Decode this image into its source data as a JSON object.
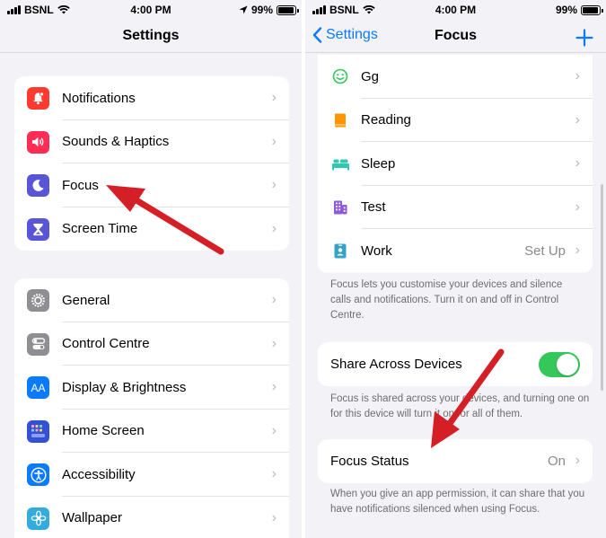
{
  "left": {
    "status": {
      "carrier": "BSNL",
      "time": "4:00 PM",
      "battery": "99%"
    },
    "nav": {
      "title": "Settings"
    },
    "group1": [
      {
        "label": "Notifications",
        "icon": "bell-icon",
        "color": "#ff3b30"
      },
      {
        "label": "Sounds & Haptics",
        "icon": "speaker-icon",
        "color": "#ff2d55"
      },
      {
        "label": "Focus",
        "icon": "moon-icon",
        "color": "#5856d6"
      },
      {
        "label": "Screen Time",
        "icon": "hourglass-icon",
        "color": "#5856d6"
      }
    ],
    "group2": [
      {
        "label": "General",
        "icon": "gear-icon",
        "color": "#8e8e93"
      },
      {
        "label": "Control Centre",
        "icon": "switches-icon",
        "color": "#8e8e93"
      },
      {
        "label": "Display & Brightness",
        "icon": "text-size-icon",
        "color": "#0a7aff"
      },
      {
        "label": "Home Screen",
        "icon": "app-grid-icon",
        "color": "#3450d6"
      },
      {
        "label": "Accessibility",
        "icon": "accessibility-icon",
        "color": "#0a7aff"
      },
      {
        "label": "Wallpaper",
        "icon": "flower-icon",
        "color": "#35aadc"
      }
    ]
  },
  "right": {
    "status": {
      "carrier": "BSNL",
      "time": "4:00 PM",
      "battery": "99%"
    },
    "nav": {
      "back_label": "Settings",
      "title": "Focus"
    },
    "focus_modes": [
      {
        "label": "Gg",
        "icon": "smiley-icon",
        "color": "#34c759"
      },
      {
        "label": "Reading",
        "icon": "book-icon",
        "color": "#ff9500"
      },
      {
        "label": "Sleep",
        "icon": "bed-icon",
        "color": "#30c9b0"
      },
      {
        "label": "Test",
        "icon": "building-icon",
        "color": "#8e5ad7"
      },
      {
        "label": "Work",
        "icon": "badge-icon",
        "color": "#35a2c9",
        "value": "Set Up"
      }
    ],
    "focus_note": "Focus lets you customise your devices and silence calls and notifications. Turn it on and off in Control Centre.",
    "share": {
      "label": "Share Across Devices",
      "enabled": true
    },
    "share_note": "Focus is shared across your devices, and turning one on for this device will turn it on for all of them.",
    "status_row": {
      "label": "Focus Status",
      "value": "On"
    },
    "status_note": "When you give an app permission, it can share that you have notifications silenced when using Focus."
  },
  "colors": {
    "accent": "#0a7aff",
    "arrow": "#d41f26",
    "toggle_on": "#34c759"
  }
}
